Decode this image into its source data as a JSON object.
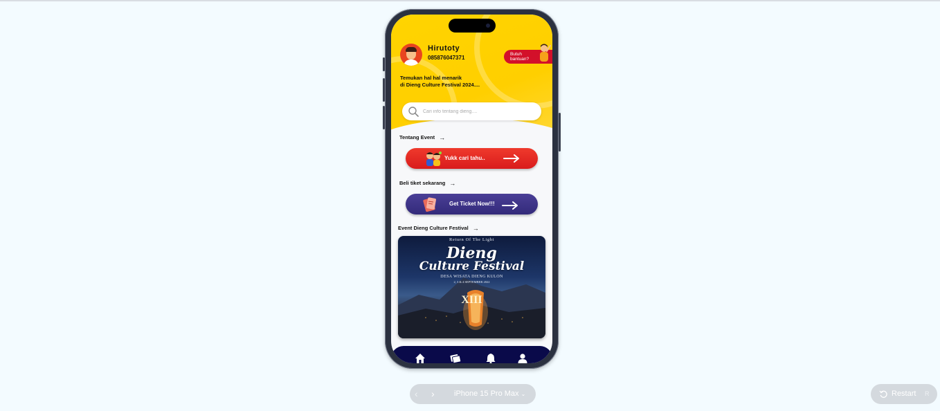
{
  "profile": {
    "name": "Hirutoty",
    "phone": "085876047371"
  },
  "help": {
    "label": "Butuh bantuan?"
  },
  "tagline": "Temukan hal hal menarik\ndi Dieng Culture Festival 2024....",
  "search": {
    "placeholder": "Cari info tentang dieng...."
  },
  "sections": {
    "about": "Tentang Event",
    "tickets": "Beli tiket sekarang",
    "event": "Event Dieng Culture Festival"
  },
  "banners": {
    "about_label": "Yukk cari tahu..",
    "ticket_label": "Get Ticket Now!!!"
  },
  "poster": {
    "subtitle_top": "Return Of The Light",
    "title_line1": "Dieng",
    "title_line2": "Culture Festival",
    "location": "DESA WISATA DIENG KULON",
    "dates": "2, 3 & 4 SEPTEMBER 2022",
    "edition": "XIII"
  },
  "navbar": {
    "items": [
      "home-icon",
      "ticket-icon",
      "bell-icon",
      "user-icon"
    ]
  },
  "toolbar": {
    "device": "iPhone 15 Pro Max",
    "restart": "Restart"
  },
  "colors": {
    "header_yellow": "#ffd400",
    "red_banner": "#e32a24",
    "purple_banner": "#3d3388",
    "navbar": "#0a0a4a"
  }
}
